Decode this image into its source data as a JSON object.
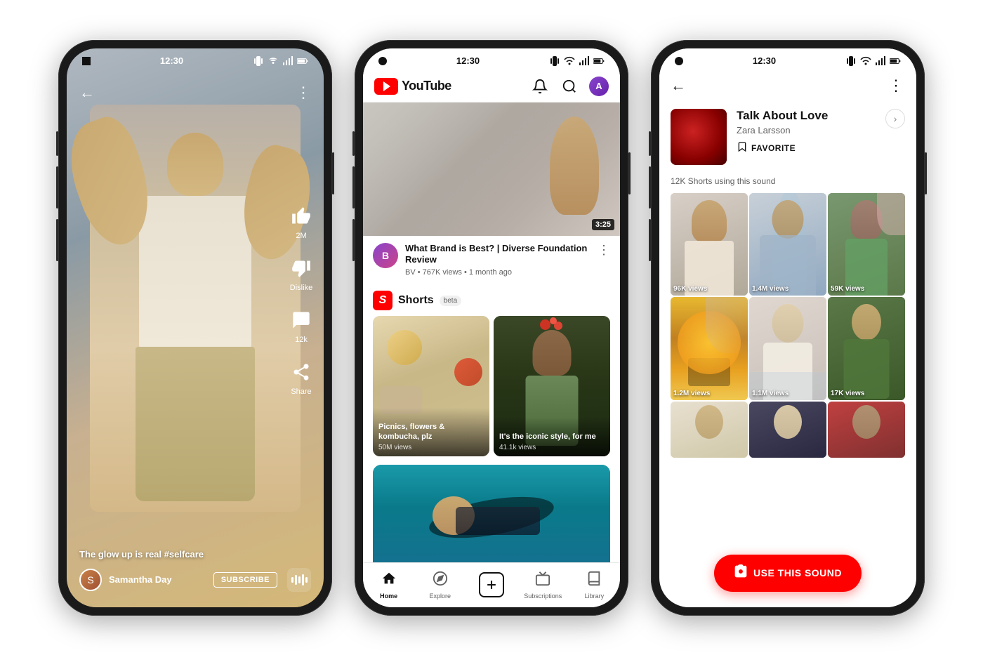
{
  "phones": [
    {
      "id": "shorts-player",
      "status": {
        "time": "12:30",
        "icons": [
          "vibrate",
          "wifi",
          "signal",
          "battery"
        ]
      },
      "back_icon": "←",
      "more_icon": "⋮",
      "content": {
        "controls": [
          {
            "icon": "👍",
            "label": "2M",
            "name": "like"
          },
          {
            "icon": "👎",
            "label": "Dislike",
            "name": "dislike"
          },
          {
            "icon": "💬",
            "label": "12k",
            "name": "comments"
          },
          {
            "icon": "↗",
            "label": "Share",
            "name": "share"
          }
        ],
        "caption": "The glow up is real ",
        "hashtag": "#selfcare",
        "username": "Samantha Day",
        "subscribe_label": "SUBSCRIBE"
      }
    },
    {
      "id": "youtube-home",
      "status": {
        "time": "12:30",
        "icons": [
          "vibrate",
          "wifi",
          "signal",
          "battery"
        ]
      },
      "header": {
        "logo_text": "YouTube",
        "icons": [
          "bell",
          "search",
          "avatar"
        ]
      },
      "featured_video": {
        "duration": "3:25",
        "title": "What Brand is Best? | Diverse Foundation Review",
        "channel": "BV",
        "meta": "BV • 767K views • 1 month ago"
      },
      "shorts_section": {
        "title": "Shorts",
        "badge": "beta",
        "items": [
          {
            "label": "Picnics, flowers & kombucha, plz",
            "views": "50M views"
          },
          {
            "label": "It's the iconic style, for me",
            "views": "41.1k views"
          }
        ]
      },
      "nav": [
        {
          "icon": "🏠",
          "label": "Home",
          "active": true
        },
        {
          "icon": "🧭",
          "label": "Explore",
          "active": false
        },
        {
          "icon": "+",
          "label": "",
          "add": true
        },
        {
          "icon": "📋",
          "label": "Subscriptions",
          "active": false
        },
        {
          "icon": "📚",
          "label": "Library",
          "active": false
        }
      ]
    },
    {
      "id": "sound-detail",
      "status": {
        "time": "12:30",
        "icons": [
          "vibrate",
          "wifi",
          "signal",
          "battery"
        ]
      },
      "header": {
        "back_icon": "←",
        "more_icon": "⋮"
      },
      "sound": {
        "title": "Talk About Love",
        "artist": "Zara Larsson",
        "favorite_label": "FAVORITE",
        "count": "12K Shorts using this sound"
      },
      "grid_items": [
        {
          "views": "96K views",
          "class": "gi-1"
        },
        {
          "views": "1.4M views",
          "class": "gi-2"
        },
        {
          "views": "59K views",
          "class": "gi-3"
        },
        {
          "views": "1.2M views",
          "class": "gi-4"
        },
        {
          "views": "1.1M views",
          "class": "gi-5"
        },
        {
          "views": "17K views",
          "class": "gi-6"
        },
        {
          "views": "",
          "class": "gi-7"
        },
        {
          "views": "",
          "class": "gi-8"
        },
        {
          "views": "",
          "class": "gi-9"
        }
      ],
      "use_sound_button": "USE THIS SOUND"
    }
  ]
}
